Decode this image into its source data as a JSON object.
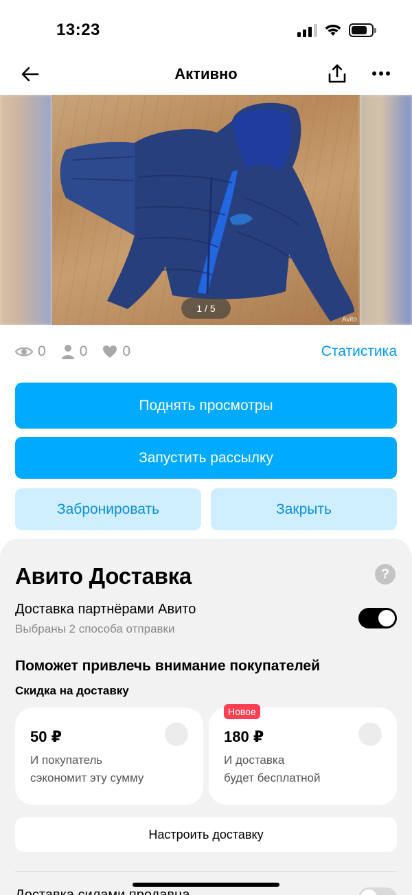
{
  "status_bar": {
    "time": "13:23"
  },
  "nav": {
    "title": "Активно"
  },
  "gallery": {
    "counter": "1 / 5",
    "watermark": "Avito"
  },
  "stats": {
    "views": "0",
    "contacts": "0",
    "favorites": "0",
    "link": "Статистика"
  },
  "actions": {
    "raise_views": "Поднять просмотры",
    "start_mailing": "Запустить рассылку",
    "reserve": "Забронировать",
    "close": "Закрыть"
  },
  "delivery": {
    "title": "Авито Доставка",
    "help_symbol": "?",
    "partner_label": "Доставка партнёрами Авито",
    "partner_sub": "Выбраны 2 способа отправки",
    "partner_enabled": true,
    "heading": "Поможет привлечь внимание покупателей",
    "subheading": "Скидка на доставку",
    "options": [
      {
        "price": "50 ₽",
        "line1": "И покупатель",
        "line2": "сэкономит эту сумму"
      },
      {
        "price": "180 ₽",
        "line1": "И доставка",
        "line2": "будет бесплатной",
        "badge": "Новое"
      }
    ],
    "setup_button": "Настроить доставку",
    "bottom_label": "Доставка силами продавца",
    "bottom_enabled": false
  },
  "colors": {
    "accent": "#00aaff",
    "accent_light": "#cfeeff",
    "link": "#0099f7",
    "badge": "#ff4053"
  }
}
